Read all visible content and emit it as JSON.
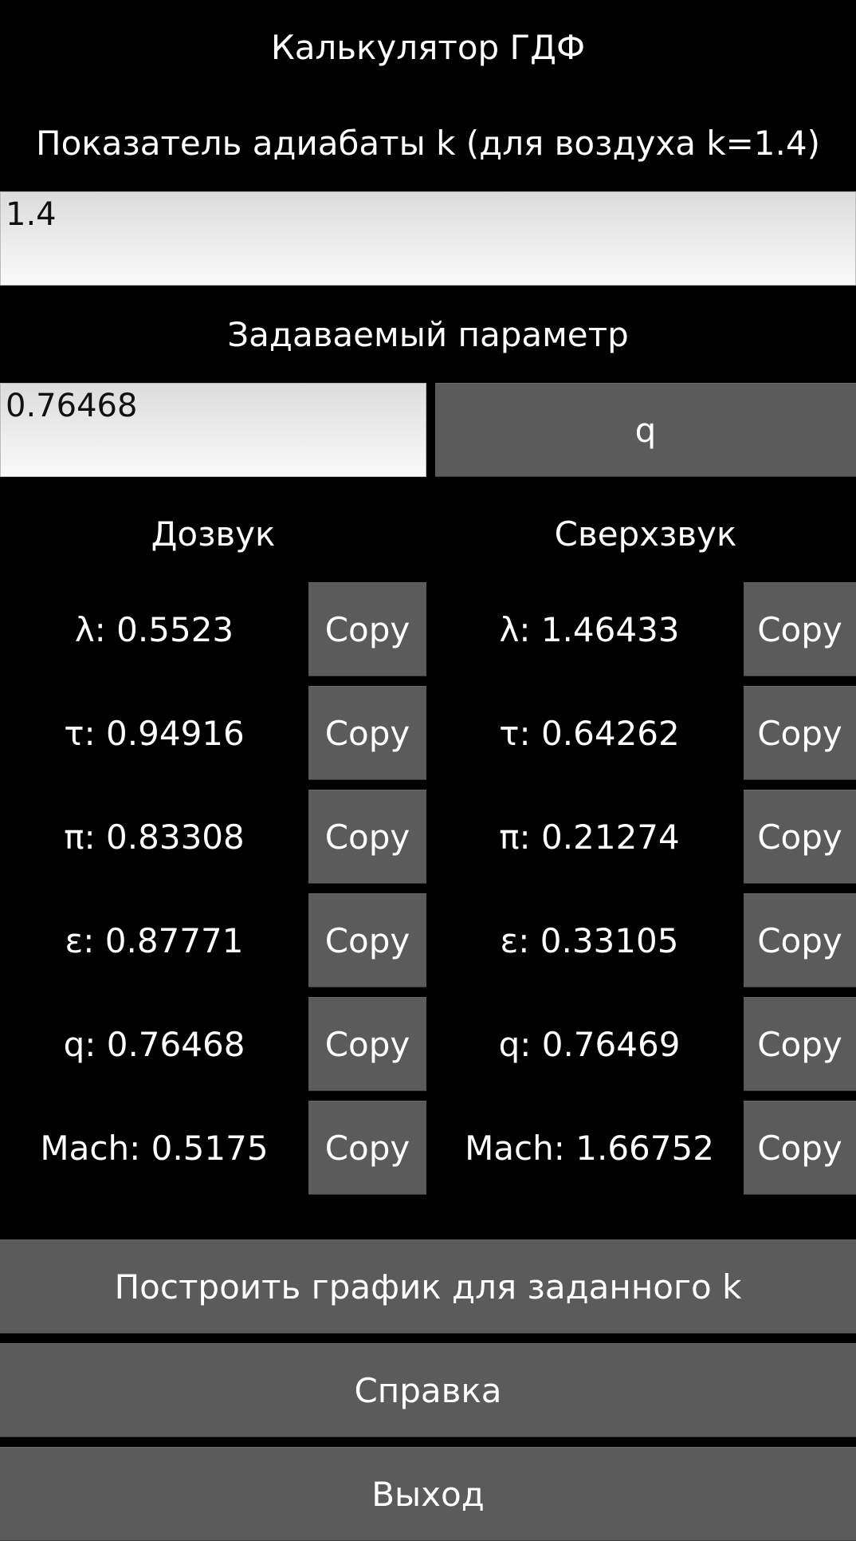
{
  "title": "Калькулятор ГДФ",
  "k_label": "Показатель адиабаты k (для воздуха k=1.4)",
  "k_input": "1.4",
  "param_label": "Задаваемый параметр",
  "param_input": "0.76468",
  "param_type_button": "q",
  "subsonic": {
    "header": "Дозвук",
    "rows": [
      {
        "text": "λ: 0.5523",
        "copy": "Copy"
      },
      {
        "text": "τ: 0.94916",
        "copy": "Copy"
      },
      {
        "text": "π: 0.83308",
        "copy": "Copy"
      },
      {
        "text": "ε: 0.87771",
        "copy": "Copy"
      },
      {
        "text": "q: 0.76468",
        "copy": "Copy"
      },
      {
        "text": "Mach: 0.5175",
        "copy": "Copy"
      }
    ]
  },
  "supersonic": {
    "header": "Сверхзвук",
    "rows": [
      {
        "text": "λ: 1.46433",
        "copy": "Copy"
      },
      {
        "text": "τ: 0.64262",
        "copy": "Copy"
      },
      {
        "text": "π: 0.21274",
        "copy": "Copy"
      },
      {
        "text": "ε: 0.33105",
        "copy": "Copy"
      },
      {
        "text": "q: 0.76469",
        "copy": "Copy"
      },
      {
        "text": "Mach: 1.66752",
        "copy": "Copy"
      }
    ]
  },
  "buttons": {
    "plot": "Построить график для заданного k",
    "help": "Справка",
    "exit": "Выход"
  }
}
